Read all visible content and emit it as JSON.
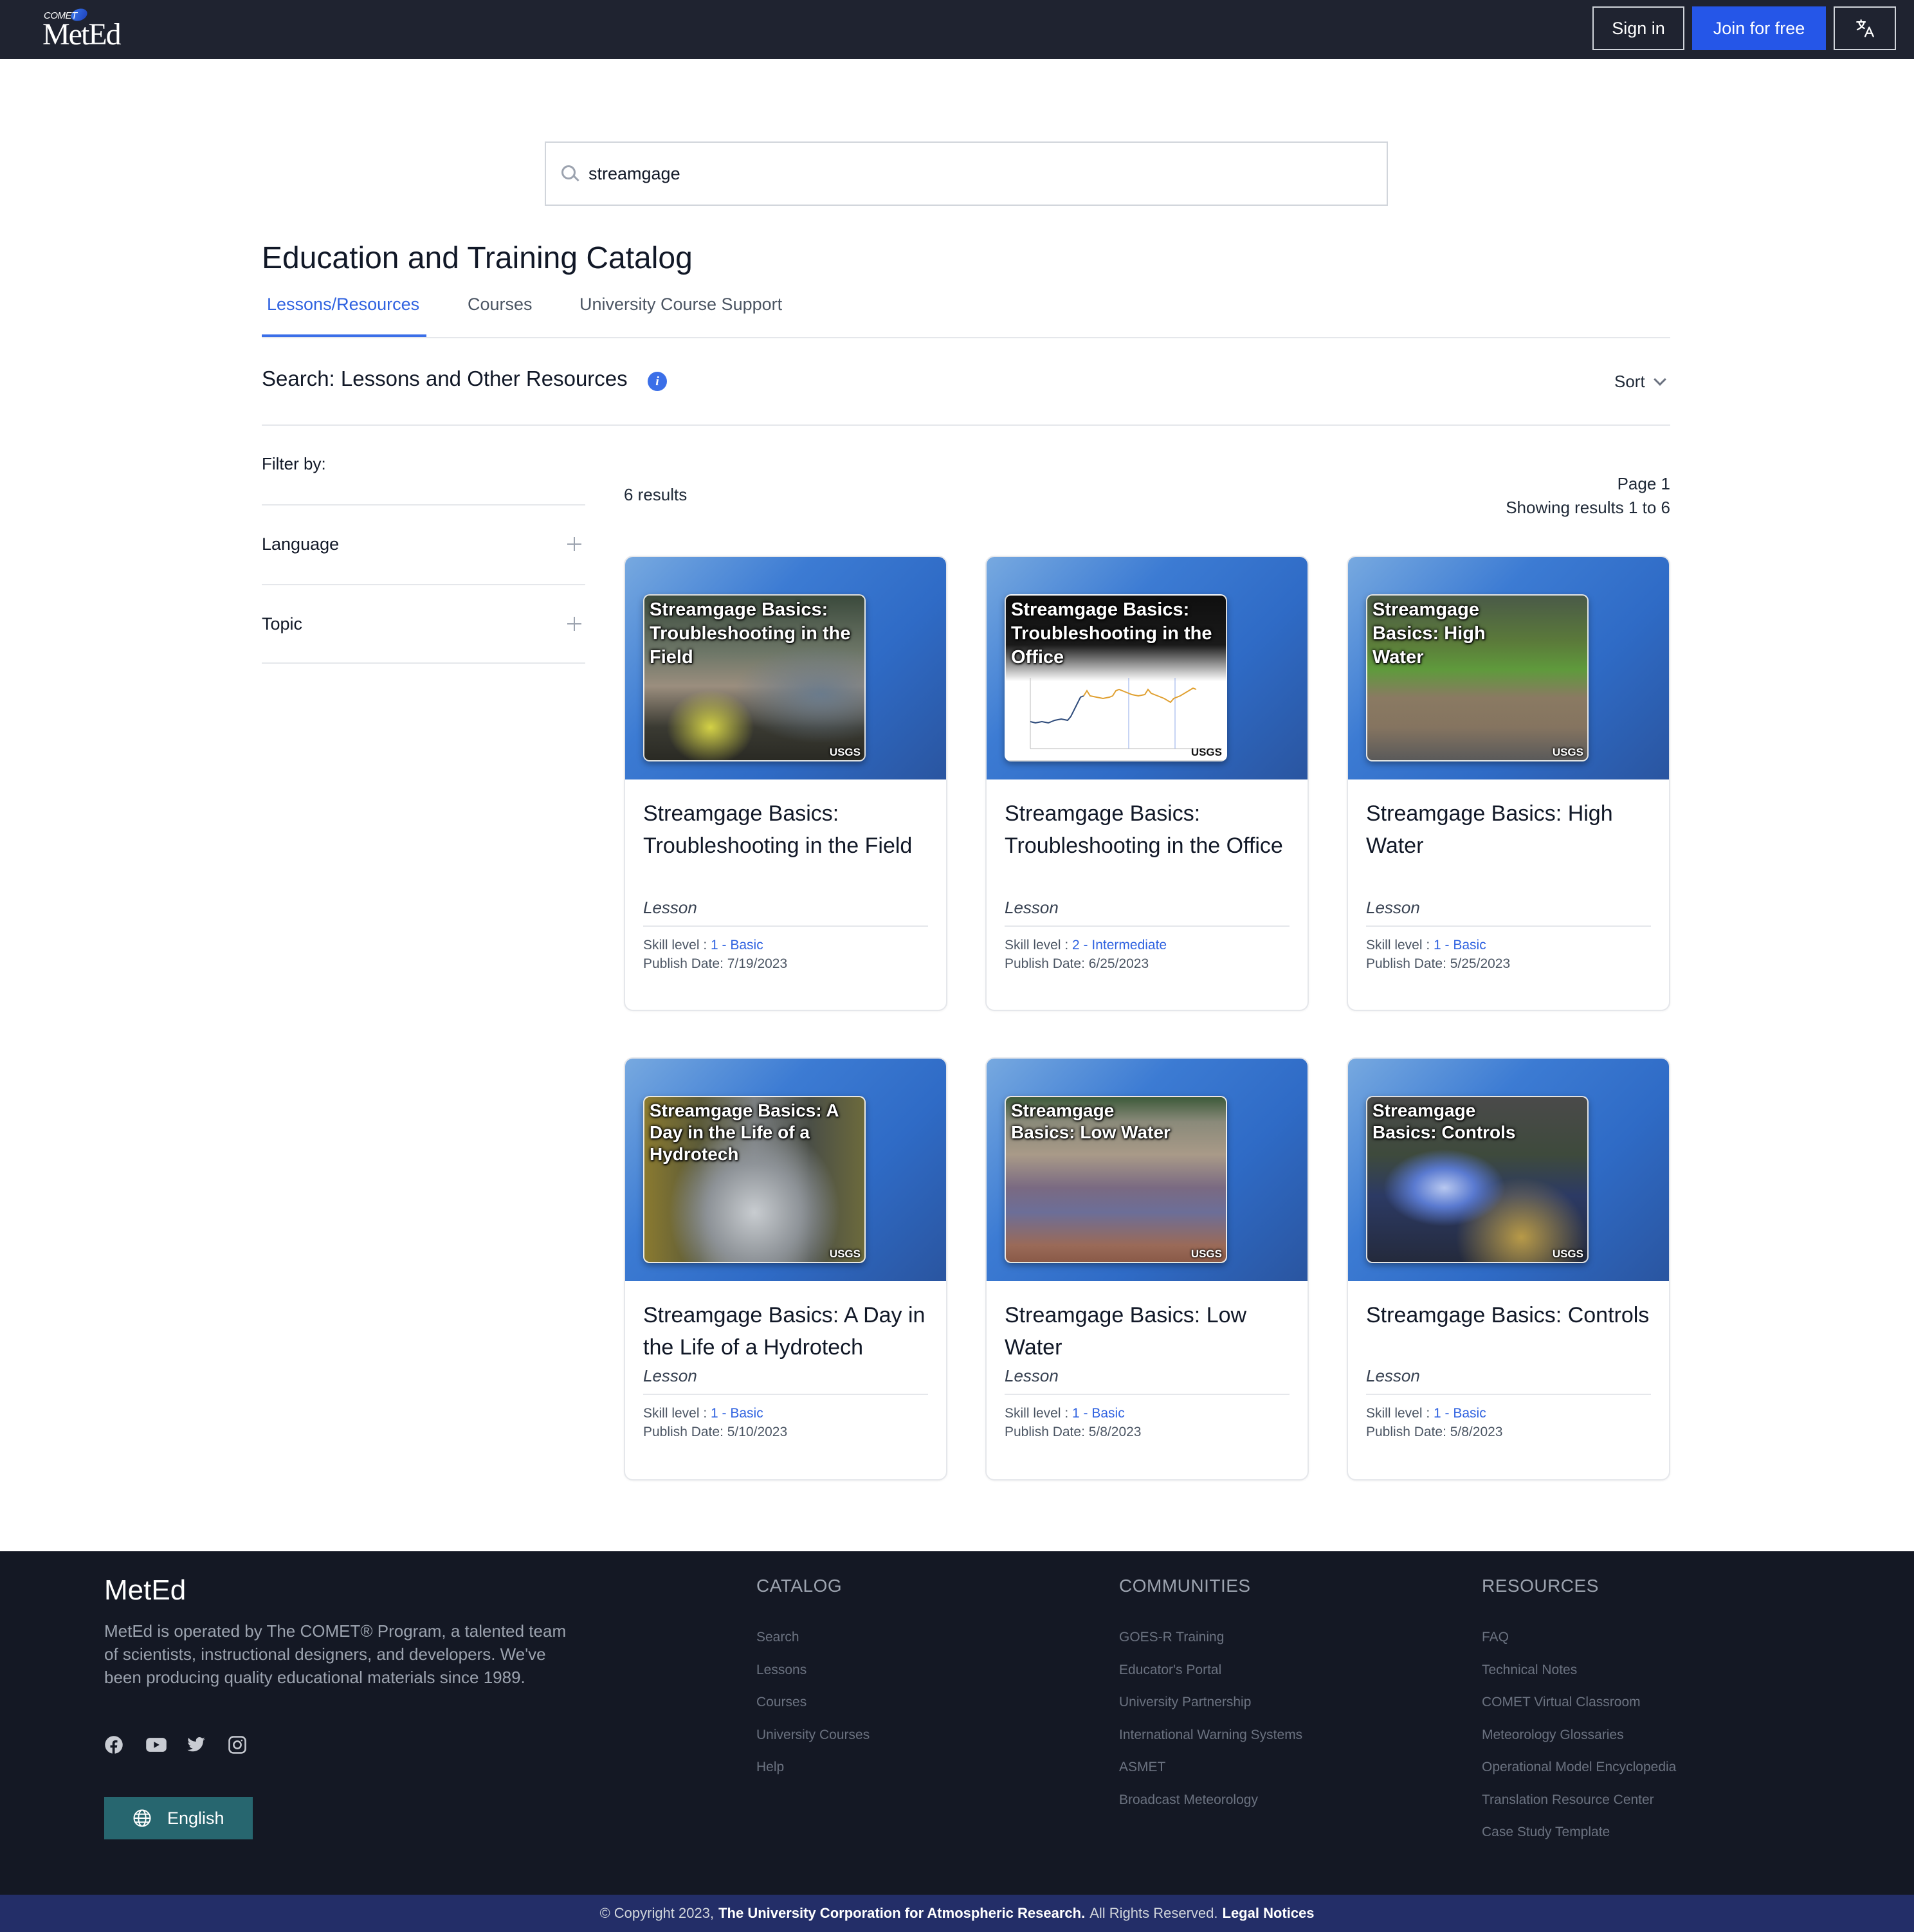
{
  "header": {
    "logo_small": "COMET",
    "logo_main": "MetEd",
    "sign_in": "Sign in",
    "join": "Join for free",
    "translate_icon": "translate-icon",
    "join_color": "#2556e8"
  },
  "search": {
    "value": "streamgage",
    "icon": "search-icon"
  },
  "page": {
    "title": "Education and Training Catalog",
    "tabs": [
      {
        "label": "Lessons/Resources",
        "active": true
      },
      {
        "label": "Courses",
        "active": false
      },
      {
        "label": "University Course Support",
        "active": false
      }
    ],
    "section_title": "Search: Lessons and Other Resources",
    "sort_label": "Sort",
    "accent_color": "#2f62e0"
  },
  "filters": {
    "label": "Filter by:",
    "items": [
      {
        "label": "Language"
      },
      {
        "label": "Topic"
      }
    ]
  },
  "results": {
    "count": "6 results",
    "page": "Page 1",
    "showing": "Showing results 1 to 6"
  },
  "cards": [
    {
      "thumb_caption": "Streamgage Basics: Troubleshooting in the Field",
      "thumb_credit": "USGS",
      "title": "Streamgage Basics: Troubleshooting in the Field",
      "type": "Lesson",
      "skill_label": "Skill level : ",
      "skill_value": "1 - Basic",
      "publish": "Publish Date: 7/19/2023"
    },
    {
      "thumb_caption": "Streamgage Basics: Troubleshooting in the Office",
      "thumb_credit": "USGS",
      "title": "Streamgage Basics: Troubleshooting in the Office",
      "type": "Lesson",
      "skill_label": "Skill level : ",
      "skill_value": "2 - Intermediate",
      "publish": "Publish Date: 6/25/2023"
    },
    {
      "thumb_caption": "Streamgage Basics: High Water",
      "thumb_credit": "USGS",
      "title": "Streamgage Basics: High Water",
      "type": "Lesson",
      "skill_label": "Skill level : ",
      "skill_value": "1 - Basic",
      "publish": "Publish Date: 5/25/2023"
    },
    {
      "thumb_caption": "Streamgage Basics: A Day in the Life of a Hydrotech",
      "thumb_credit": "USGS",
      "title": "Streamgage Basics: A Day in the Life of a Hydrotech",
      "type": "Lesson",
      "skill_label": "Skill level : ",
      "skill_value": "1 - Basic",
      "publish": "Publish Date: 5/10/2023"
    },
    {
      "thumb_caption": "Streamgage Basics: Low Water",
      "thumb_credit": "USGS",
      "title": "Streamgage Basics: Low Water",
      "type": "Lesson",
      "skill_label": "Skill level : ",
      "skill_value": "1 - Basic",
      "publish": "Publish Date: 5/8/2023"
    },
    {
      "thumb_caption": "Streamgage Basics: Controls",
      "thumb_credit": "USGS",
      "title": "Streamgage Basics: Controls",
      "type": "Lesson",
      "skill_label": "Skill level : ",
      "skill_value": "1 - Basic",
      "publish": "Publish Date: 5/8/2023"
    }
  ],
  "footer": {
    "brand": "MetEd",
    "description": "MetEd is operated by The COMET® Program, a talented team of scientists, instructional designers, and developers. We've been producing quality educational materials since 1989.",
    "social": [
      "facebook-icon",
      "youtube-icon",
      "twitter-icon",
      "instagram-icon"
    ],
    "language_button": "English",
    "language_color": "#27666f",
    "columns": [
      {
        "heading": "CATALOG",
        "links": [
          "Search",
          "Lessons",
          "Courses",
          "University Courses",
          "Help"
        ]
      },
      {
        "heading": "COMMUNITIES",
        "links": [
          "GOES-R Training",
          "Educator's Portal",
          "University Partnership",
          "International Warning Systems",
          "ASMET",
          "Broadcast Meteorology"
        ]
      },
      {
        "heading": "RESOURCES",
        "links": [
          "FAQ",
          "Technical Notes",
          "COMET Virtual Classroom",
          "Meteorology Glossaries",
          "Operational Model Encyclopedia",
          "Translation Resource Center",
          "Case Study Template"
        ]
      }
    ],
    "copyright_prefix": "© Copyright 2023,",
    "copyright_org": "The University Corporation for Atmospheric Research.",
    "copyright_rights": "All Rights Reserved.",
    "legal_link": "Legal Notices"
  }
}
